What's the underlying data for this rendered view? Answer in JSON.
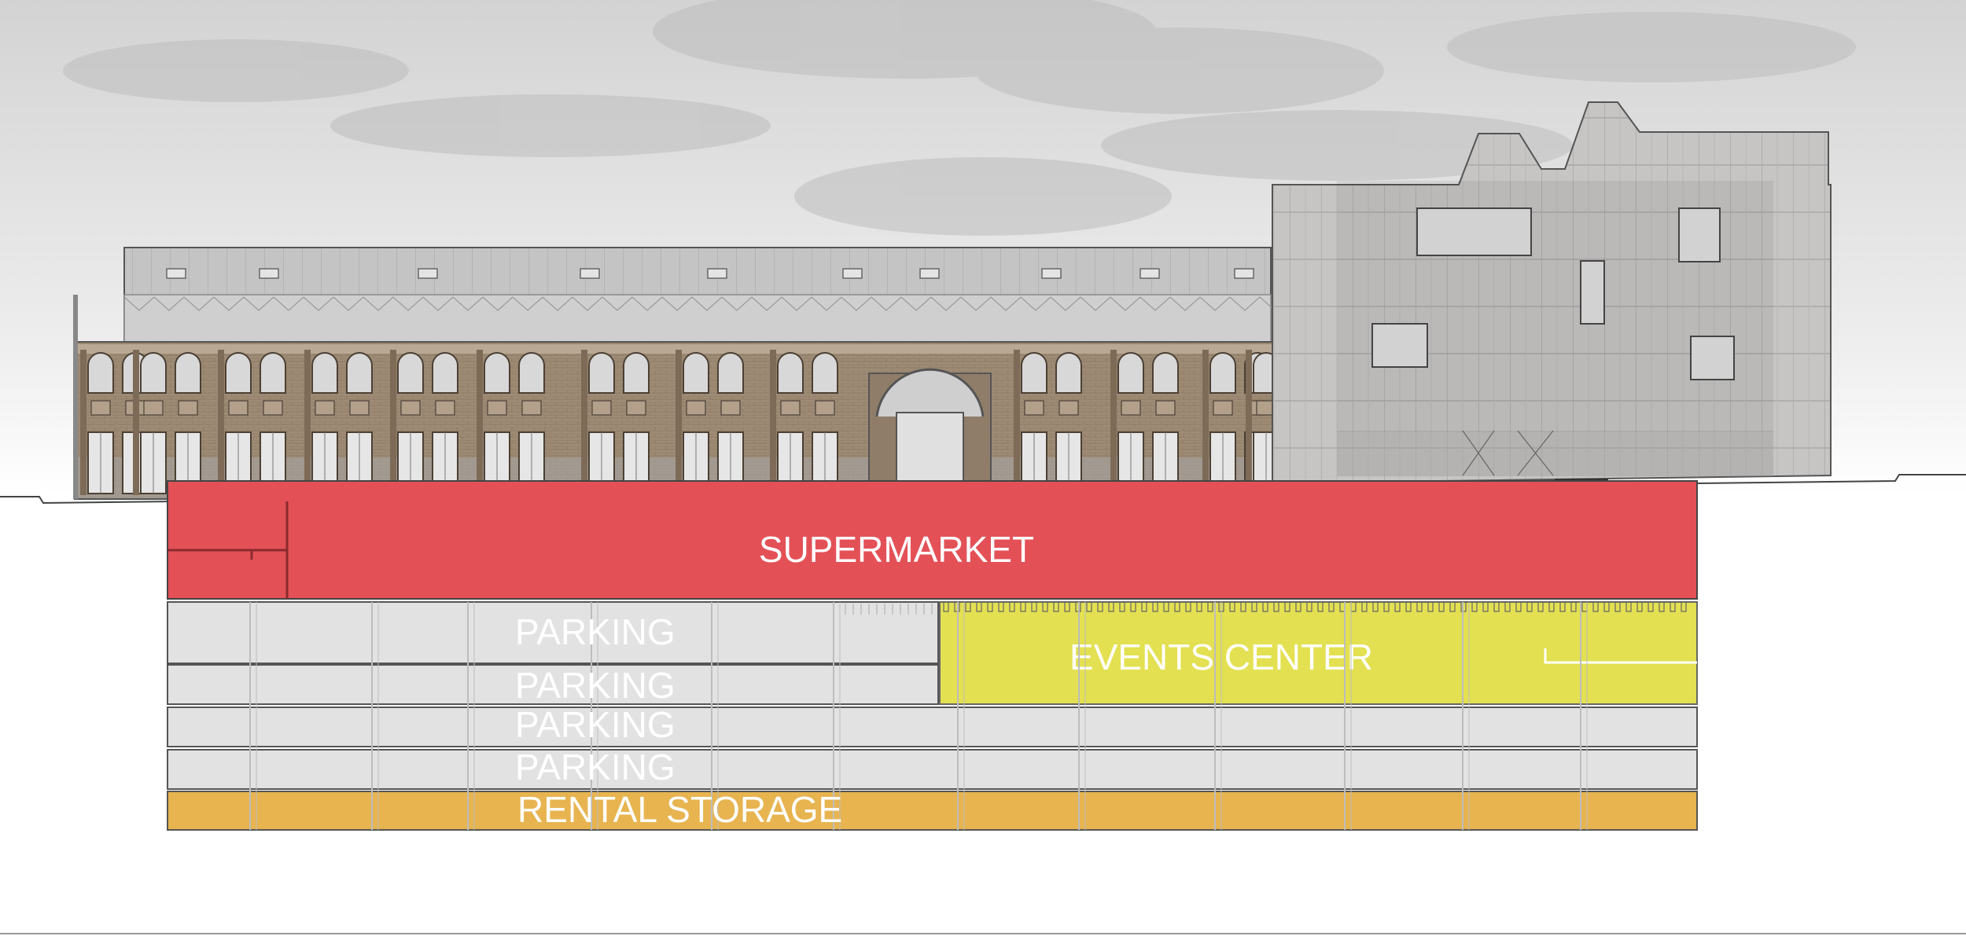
{
  "zones": {
    "supermarket": {
      "label": "SUPERMARKET",
      "color": "#e35157"
    },
    "events": {
      "label": "EVENTS CENTER",
      "color": "#e3e051"
    },
    "parking": {
      "labels": [
        "PARKING",
        "PARKING",
        "PARKING",
        "PARKING"
      ],
      "color": "#e2e2e2"
    },
    "storage": {
      "label": "RENTAL STORAGE",
      "color": "#e7b450"
    }
  },
  "colors": {
    "sky_top": "#d6d6d6",
    "sky_bottom": "#ffffff",
    "brick": "#9c8a76",
    "facade_panel": "#c9c9c9",
    "outline": "#555555"
  }
}
